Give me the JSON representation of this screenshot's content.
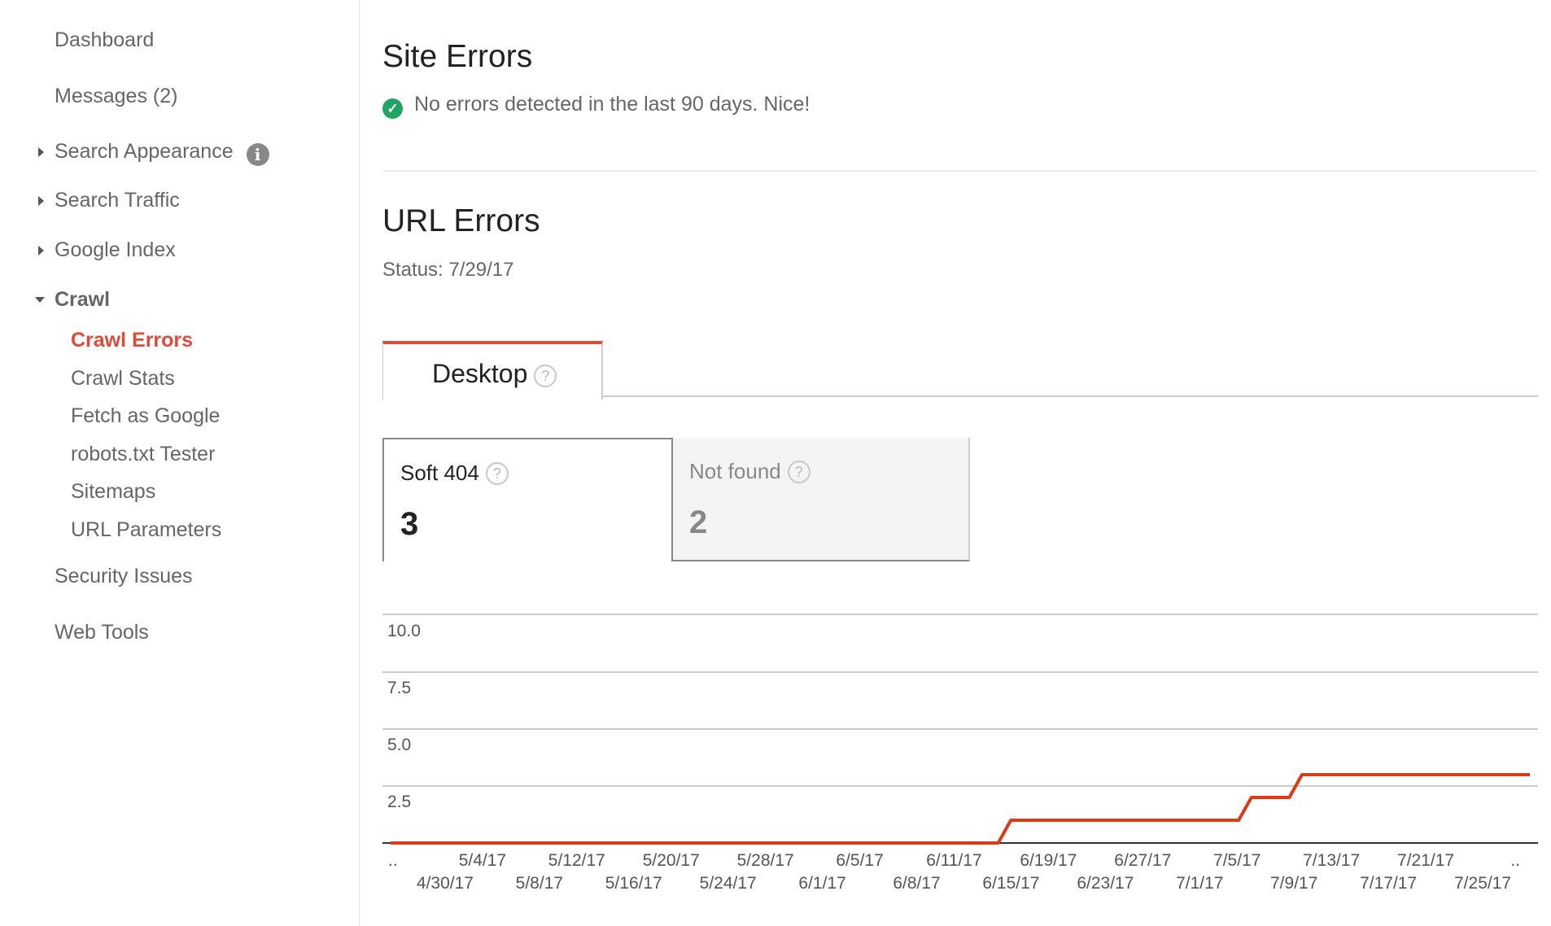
{
  "sidebar": {
    "items": [
      {
        "label": "Dashboard"
      },
      {
        "label": "Messages (2)"
      },
      {
        "label": "Search Appearance",
        "info_icon": "info-icon"
      },
      {
        "label": "Search Traffic"
      },
      {
        "label": "Google Index"
      },
      {
        "label": "Crawl",
        "expanded": true,
        "children": [
          {
            "label": "Crawl Errors",
            "active": true
          },
          {
            "label": "Crawl Stats"
          },
          {
            "label": "Fetch as Google"
          },
          {
            "label": "robots.txt Tester"
          },
          {
            "label": "Sitemaps"
          },
          {
            "label": "URL Parameters"
          }
        ]
      },
      {
        "label": "Security Issues"
      },
      {
        "label": "Web Tools"
      }
    ]
  },
  "site_errors": {
    "title": "Site Errors",
    "message": "No errors detected in the last 90 days. Nice!",
    "status_icon": "check-circle-icon"
  },
  "url_errors": {
    "title": "URL Errors",
    "status": "Status: 7/29/17",
    "tabs": [
      {
        "label": "Desktop",
        "active": true
      }
    ],
    "cards": [
      {
        "label": "Soft 404",
        "value": "3",
        "selected": true
      },
      {
        "label": "Not found",
        "value": "2",
        "selected": false
      }
    ]
  },
  "colors": {
    "accent": "#dd4b39",
    "series": "#dd3a1a",
    "success": "#1fa463"
  },
  "chart_data": {
    "type": "line",
    "title": "",
    "xlabel": "",
    "ylabel": "",
    "ylim": [
      0,
      10
    ],
    "yticks": [
      "2.5",
      "5.0",
      "7.5",
      "10.0"
    ],
    "ytick_values": [
      2.5,
      5.0,
      7.5,
      10.0
    ],
    "grid": true,
    "xrange": [
      "4/29/17",
      "7/28/17"
    ],
    "xtick_labels_top": [
      "..",
      "5/4/17",
      "5/12/17",
      "5/20/17",
      "5/28/17",
      "6/5/17",
      "6/11/17",
      "6/19/17",
      "6/27/17",
      "7/5/17",
      "7/13/17",
      "7/21/17",
      ".."
    ],
    "xtick_labels_bottom": [
      "4/30/17",
      "5/8/17",
      "5/16/17",
      "5/24/17",
      "6/1/17",
      "6/8/17",
      "6/15/17",
      "6/23/17",
      "7/1/17",
      "7/9/17",
      "7/17/17",
      "7/25/17"
    ],
    "series": [
      {
        "name": "Soft 404",
        "points": [
          {
            "x": "4/29/17",
            "y": 0
          },
          {
            "x": "6/16/17",
            "y": 0
          },
          {
            "x": "6/17/17",
            "y": 1
          },
          {
            "x": "7/5/17",
            "y": 1
          },
          {
            "x": "7/6/17",
            "y": 2
          },
          {
            "x": "7/9/17",
            "y": 2
          },
          {
            "x": "7/10/17",
            "y": 3
          },
          {
            "x": "7/28/17",
            "y": 3
          }
        ]
      }
    ]
  }
}
